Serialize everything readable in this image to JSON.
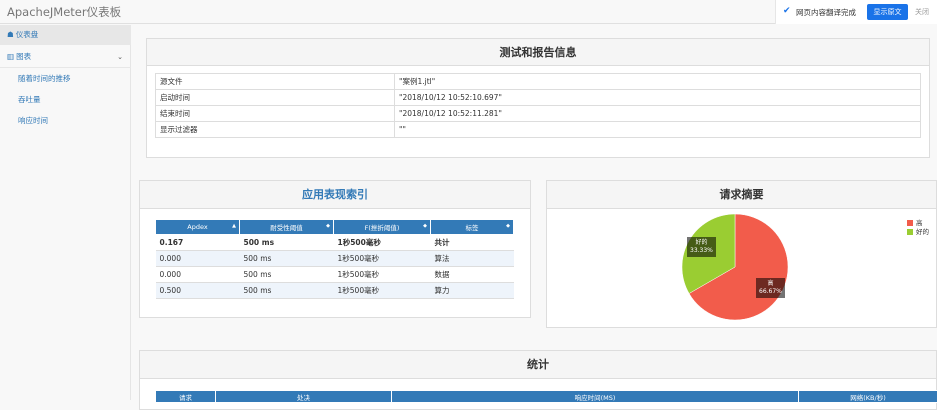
{
  "app": {
    "title": "ApacheJMeter仪表板"
  },
  "translate": {
    "message": "网页内容翻译完成",
    "button": "显示原文",
    "close": "关闭"
  },
  "sidebar": {
    "dashboard": "仪表盘",
    "charts": "图表",
    "sub_items": [
      "随着时间的推移",
      "吞吐量",
      "响应时间"
    ]
  },
  "info_panel": {
    "title": "测试和报告信息",
    "rows": [
      {
        "label": "源文件",
        "value": "\"案例1.jtl\""
      },
      {
        "label": "启动时间",
        "value": "\"2018/10/12 10:52:10.697\""
      },
      {
        "label": "结束时间",
        "value": "\"2018/10/12 10:52:11.281\""
      },
      {
        "label": "显示过滤器",
        "value": "\"\""
      }
    ]
  },
  "apdex_panel": {
    "title": "应用表现索引",
    "headers": [
      "Apdex",
      "耐受性阈值",
      "F(挫折阈值)",
      "标签"
    ],
    "rows": [
      [
        "0.167",
        "500 ms",
        "1秒500毫秒",
        "共计"
      ],
      [
        "0.000",
        "500 ms",
        "1秒500毫秒",
        "算法"
      ],
      [
        "0.000",
        "500 ms",
        "1秒500毫秒",
        "数据"
      ],
      [
        "0.500",
        "500 ms",
        "1秒500毫秒",
        "算力"
      ]
    ]
  },
  "summary_panel": {
    "title": "请求摘要",
    "legend": [
      "高",
      "好的"
    ]
  },
  "chart_data": {
    "type": "pie",
    "title": "请求摘要",
    "categories": [
      "高",
      "好的"
    ],
    "values": [
      66.67,
      33.33
    ],
    "value_labels": [
      "66.67%",
      "33.33%"
    ],
    "colors": [
      "#f25c4b",
      "#9acd32"
    ],
    "legend_position": "top-right"
  },
  "stats_panel": {
    "title": "统计",
    "headers": [
      "请求",
      "处决",
      "响应时间(MS)",
      "网络(KB/秒)"
    ]
  }
}
